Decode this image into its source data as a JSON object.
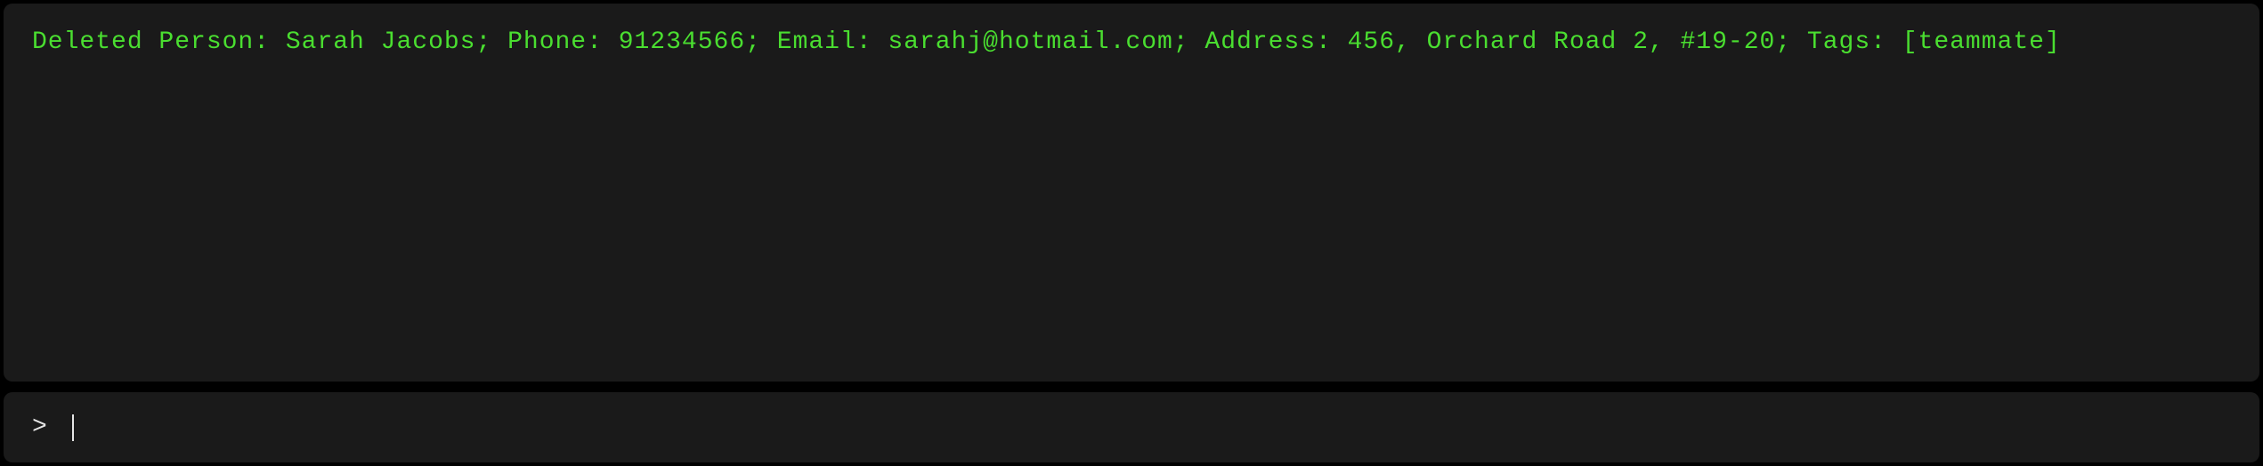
{
  "output": {
    "message": "Deleted Person: Sarah Jacobs; Phone: 91234566; Email: sarahj@hotmail.com; Address: 456, Orchard Road 2, #19-20; Tags: [teammate]"
  },
  "input": {
    "prompt": ">",
    "value": ""
  }
}
